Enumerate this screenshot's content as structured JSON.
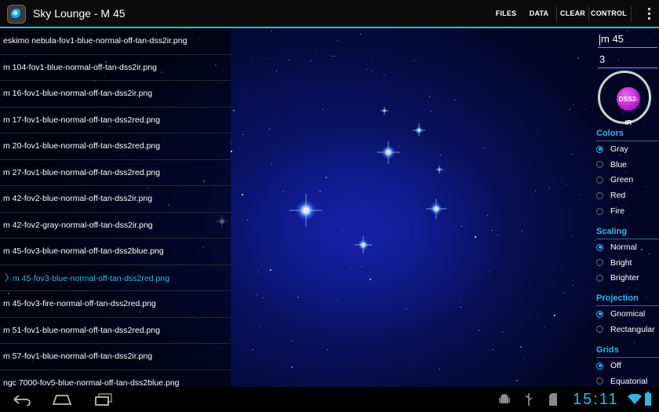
{
  "app": {
    "title": "Sky Lounge - M 45"
  },
  "actions": [
    {
      "label": "FILES"
    },
    {
      "label": "DATA"
    },
    {
      "label": "CLEAR"
    },
    {
      "label": "CONTROL"
    }
  ],
  "files": [
    {
      "name": "eskimo nebula-fov1-blue-normal-off-tan-dss2ir.png",
      "selected": false
    },
    {
      "name": "m 104-fov1-blue-normal-off-tan-dss2ir.png",
      "selected": false
    },
    {
      "name": "m 16-fov1-blue-normal-off-tan-dss2ir.png",
      "selected": false
    },
    {
      "name": "m 17-fov1-blue-normal-off-tan-dss2red.png",
      "selected": false
    },
    {
      "name": "m 20-fov1-blue-normal-off-tan-dss2red.png",
      "selected": false
    },
    {
      "name": "m 27-fov1-blue-normal-off-tan-dss2red.png",
      "selected": false
    },
    {
      "name": "m 42-fov2-blue-normal-off-tan-dss2ir.png",
      "selected": false
    },
    {
      "name": "m 42-fov2-gray-normal-off-tan-dss2ir.png",
      "selected": false
    },
    {
      "name": "m 45-fov3-blue-normal-off-tan-dss2blue.png",
      "selected": false
    },
    {
      "name": "m 45-fov3-blue-normal-off-tan-dss2red.png",
      "selected": true
    },
    {
      "name": "m 45-fov3-fire-normal-off-tan-dss2red.png",
      "selected": false
    },
    {
      "name": "m 51-fov1-blue-normal-off-tan-dss2red.png",
      "selected": false
    },
    {
      "name": "m 57-fov1-blue-normal-off-tan-dss2ir.png",
      "selected": false
    },
    {
      "name": "ngc 7000-fov5-blue-normal-off-tan-dss2blue.png",
      "selected": false
    }
  ],
  "controls": {
    "object_value": "m 45",
    "fov_value": "3",
    "survey_label": "DSS2-IR",
    "colors": {
      "heading": "Colors",
      "options": [
        "Gray",
        "Blue",
        "Green",
        "Red",
        "Fire"
      ],
      "selected": "Gray"
    },
    "scaling": {
      "heading": "Scaling",
      "options": [
        "Normal",
        "Bright",
        "Brighter"
      ],
      "selected": "Normal"
    },
    "projection": {
      "heading": "Projection",
      "options": [
        "Gnomical",
        "Rectangular"
      ],
      "selected": "Gnomical"
    },
    "grids": {
      "heading": "Grids",
      "options": [
        "Off",
        "Equatorial"
      ],
      "selected": "Off"
    }
  },
  "status": {
    "clock": "15:11"
  },
  "theme": {
    "accent": "#33b5e5",
    "survey_button": "#c020d0"
  }
}
